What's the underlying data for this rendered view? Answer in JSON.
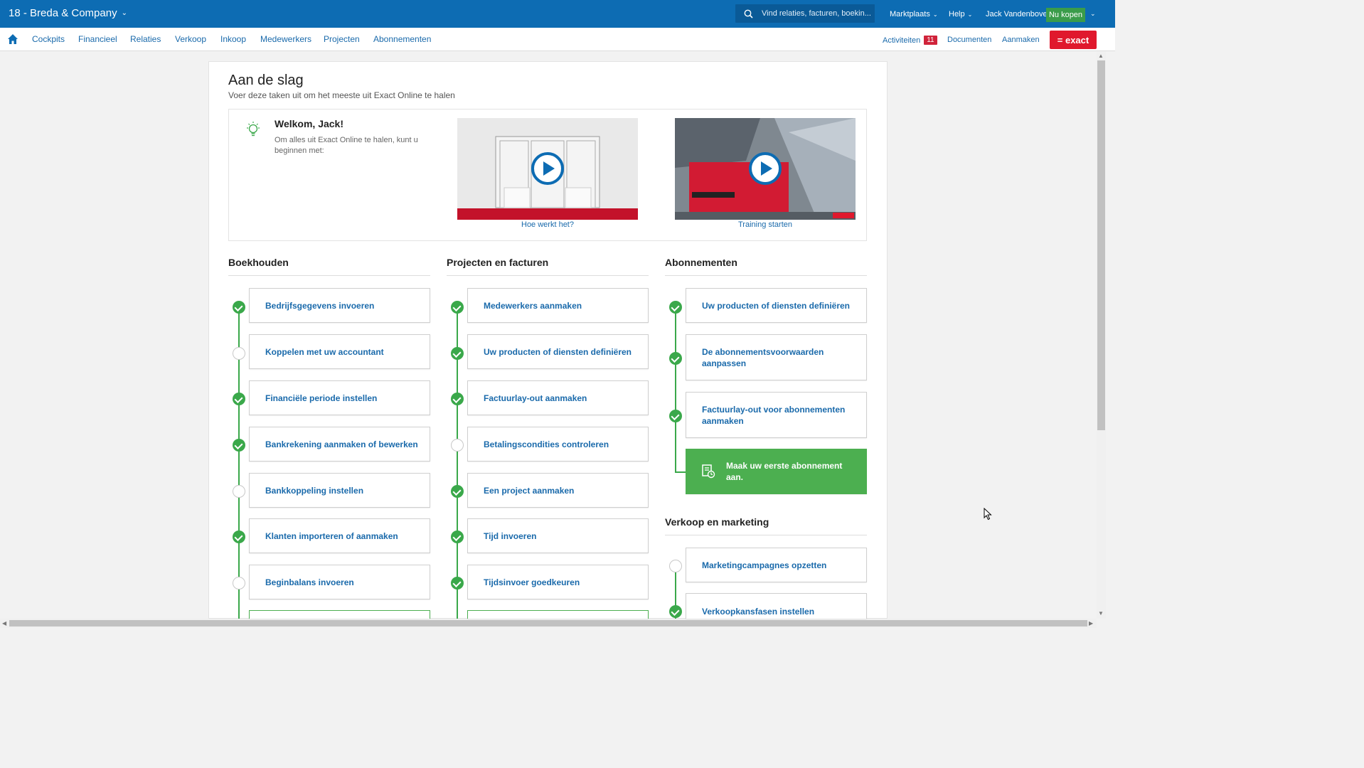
{
  "topbar": {
    "company": "18 - Breda & Company",
    "search_placeholder": "Vind relaties, facturen, boekin...",
    "marktplaats": "Marktplaats",
    "help": "Help",
    "user": "Jack Vandenbove",
    "buy": "Nu kopen",
    "icons": {
      "search": "search-icon",
      "chevron": "chevron-down-icon"
    }
  },
  "nav": {
    "items": [
      "Cockpits",
      "Financieel",
      "Relaties",
      "Verkoop",
      "Inkoop",
      "Medewerkers",
      "Projecten",
      "Abonnementen"
    ],
    "activiteiten": "Activiteiten",
    "activiteiten_count": "11",
    "documenten": "Documenten",
    "aanmaken": "Aanmaken",
    "logo": "= exact",
    "icons": {
      "home": "home-icon"
    }
  },
  "page": {
    "title": "Aan de slag",
    "subtitle": "Voer deze taken uit om het meeste uit Exact Online te halen"
  },
  "welcome": {
    "title": "Welkom, Jack!",
    "text": "Om alles uit Exact Online te halen, kunt u beginnen met:",
    "videos": [
      {
        "label": "Hoe werkt het?"
      },
      {
        "label": "Training starten"
      }
    ]
  },
  "columns": [
    {
      "title": "Boekhouden",
      "tasks": [
        {
          "label": "Bedrijfsgegevens invoeren",
          "done": true
        },
        {
          "label": "Koppelen met uw accountant",
          "done": false
        },
        {
          "label": "Financiële periode instellen",
          "done": true
        },
        {
          "label": "Bankrekening aanmaken of bewerken",
          "done": true
        },
        {
          "label": "Bankkoppeling instellen",
          "done": false
        },
        {
          "label": "Klanten importeren of aanmaken",
          "done": true
        },
        {
          "label": "Beginbalans invoeren",
          "done": false
        }
      ]
    },
    {
      "title": "Projecten en facturen",
      "tasks": [
        {
          "label": "Medewerkers aanmaken",
          "done": true
        },
        {
          "label": "Uw producten of diensten definiëren",
          "done": true
        },
        {
          "label": "Factuurlay-out aanmaken",
          "done": true
        },
        {
          "label": "Betalingscondities controleren",
          "done": false
        },
        {
          "label": "Een project aanmaken",
          "done": true
        },
        {
          "label": "Tijd invoeren",
          "done": true
        },
        {
          "label": "Tijdsinvoer goedkeuren",
          "done": true
        }
      ]
    },
    {
      "title": "Abonnementen",
      "tasks": [
        {
          "label": "Uw producten of diensten definiëren",
          "done": true
        },
        {
          "label": "De abonnementsvoorwaarden aanpassen",
          "done": true
        },
        {
          "label": "Factuurlay-out voor abonnementen aanmaken",
          "done": true
        },
        {
          "label": "Maak uw eerste abonnement aan.",
          "highlight": true
        }
      ]
    },
    {
      "title": "Verkoop en marketing",
      "tasks": [
        {
          "label": "Marketingcampagnes opzetten",
          "done": false
        },
        {
          "label": "Verkoopkansfasen instellen",
          "done": true
        }
      ]
    }
  ],
  "colors": {
    "topbar": "#0d6cb3",
    "link": "#1a6aab",
    "done": "#3aa84a",
    "highlight": "#4caf50",
    "badge": "#d0233a",
    "logo": "#e0182d"
  }
}
